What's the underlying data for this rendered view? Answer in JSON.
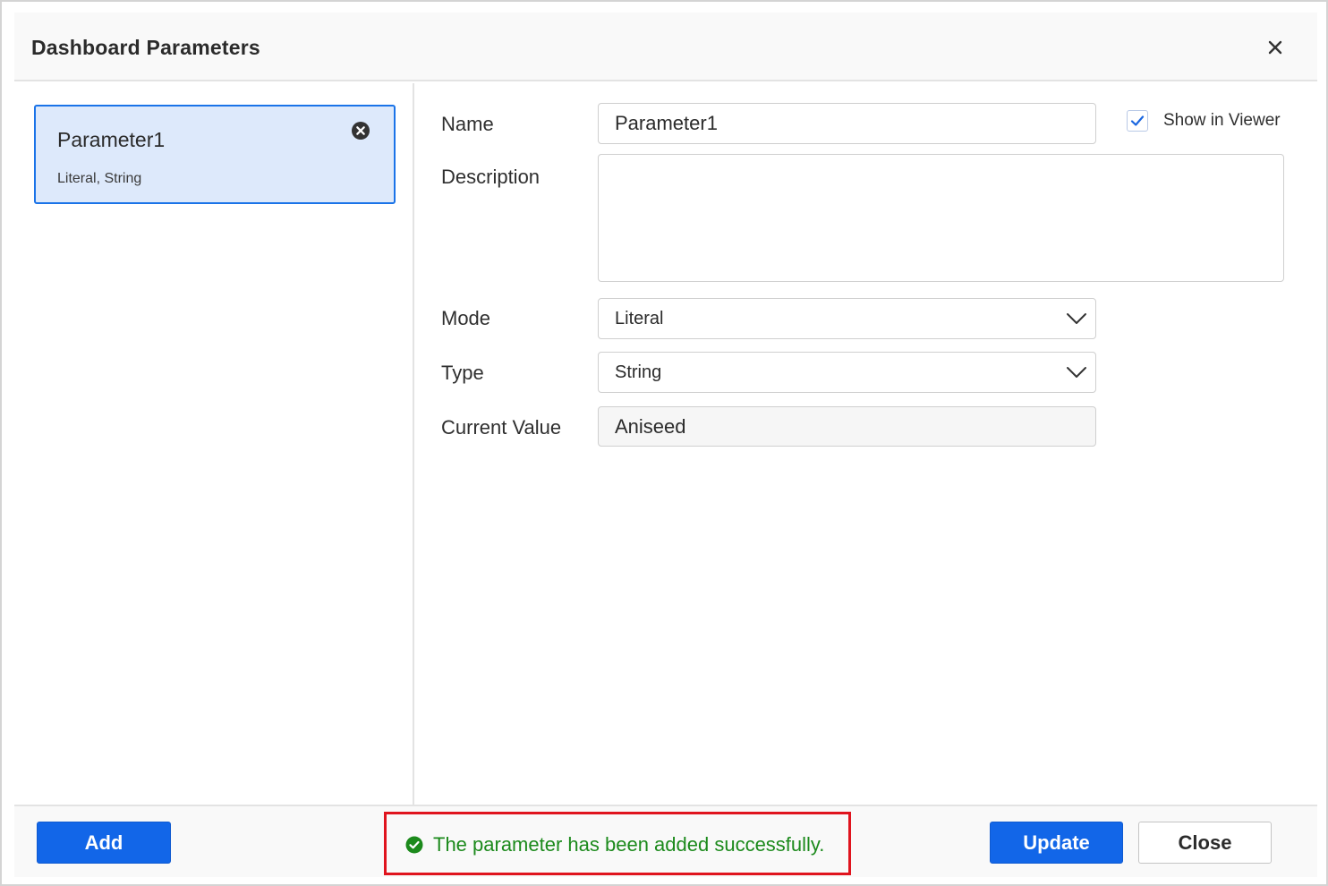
{
  "dialog": {
    "title": "Dashboard Parameters",
    "close_icon": "close-icon"
  },
  "parameters_list": [
    {
      "name": "Parameter1",
      "subtitle": "Literal, String",
      "remove_icon": "circle-x-icon",
      "selected": true
    }
  ],
  "form": {
    "name_label": "Name",
    "name_value": "Parameter1",
    "show_in_viewer_label": "Show in Viewer",
    "show_in_viewer_checked": true,
    "description_label": "Description",
    "description_value": "",
    "mode_label": "Mode",
    "mode_value": "Literal",
    "type_label": "Type",
    "type_value": "String",
    "current_value_label": "Current Value",
    "current_value": "Aniseed"
  },
  "footer": {
    "add_label": "Add",
    "status_message": "The parameter has been added successfully.",
    "status_icon": "check-circle-icon",
    "update_label": "Update",
    "close_label": "Close"
  },
  "colors": {
    "accent": "#1266e8",
    "selected_card_bg": "#dde9fb",
    "success": "#1c8a1c",
    "highlight_border": "#e0141e"
  }
}
